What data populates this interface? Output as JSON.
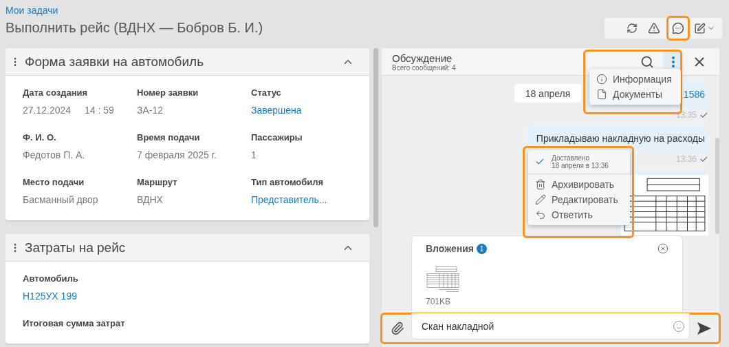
{
  "breadcrumb": "Мои задачи",
  "title": "Выполнить рейс (ВДНХ — Бобров Б. И.)",
  "toolbar": {
    "buttons": [
      {
        "kind": "refresh",
        "highlighted": false
      },
      {
        "kind": "warning",
        "highlighted": false
      },
      {
        "kind": "chat",
        "highlighted": true
      },
      {
        "kind": "edit",
        "highlighted": false
      }
    ]
  },
  "cards": [
    {
      "title": "Форма заявки на автомобиль",
      "expanded": true,
      "kind": "grid",
      "fields": [
        {
          "label": "Дата создания",
          "values": [
            "27.12.2024",
            "14 : 59"
          ],
          "link": false
        },
        {
          "label": "Номер заявки",
          "values": [
            "ЗА-12"
          ],
          "link": false
        },
        {
          "label": "Статус",
          "values": [
            "Завершена"
          ],
          "link": true
        },
        {
          "label": "Ф. И. О.",
          "values": [
            "Федотов П. А."
          ],
          "link": false
        },
        {
          "label": "Время подачи",
          "values": [
            "7 февраля 2025 г."
          ],
          "link": false
        },
        {
          "label": "Пассажиры",
          "values": [
            "1"
          ],
          "link": false
        },
        {
          "label": "Место подачи",
          "values": [
            "Басманный двор"
          ],
          "link": false
        },
        {
          "label": "Маршрут",
          "values": [
            "ВДНХ"
          ],
          "link": false
        },
        {
          "label": "Тип автомобиля",
          "values": [
            "Представитель..."
          ],
          "link": true
        }
      ]
    },
    {
      "title": "Затраты на рейс",
      "expanded": true,
      "kind": "list",
      "fields": [
        {
          "label": "Автомобиль",
          "values": [
            "Н125УХ 199"
          ],
          "link": true
        },
        {
          "label": "Итоговая сумма затрат"
        }
      ]
    }
  ],
  "chat": {
    "title": "Обсуждение",
    "subtitle": "Всего сообщений: 4",
    "header_menu": {
      "highlighted": true,
      "items": [
        {
          "kind": "info",
          "label": "Информация"
        },
        {
          "kind": "document",
          "label": "Документы"
        }
      ]
    },
    "date_divider": "18 апреля",
    "messages": [
      {
        "kind": "text",
        "text": "1586",
        "link": true,
        "time": "13:35",
        "delivered": true
      },
      {
        "kind": "text",
        "text": "Прикладываю накладную на расходы",
        "link": false,
        "time": "13:36",
        "delivered": true
      },
      {
        "kind": "image"
      }
    ],
    "context_menu": {
      "highlighted": true,
      "status": "Доставлено",
      "status_time": "18 апреля в 13:36",
      "items": [
        {
          "kind": "archive",
          "label": "Архивировать"
        },
        {
          "kind": "edit",
          "label": "Редактировать"
        },
        {
          "kind": "reply",
          "label": "Ответить"
        }
      ]
    },
    "attachments": {
      "title": "Вложения",
      "count": "1",
      "files": [
        {
          "size": "701KB"
        }
      ]
    },
    "composer": {
      "value": "Скан накладной",
      "highlighted": true
    }
  }
}
